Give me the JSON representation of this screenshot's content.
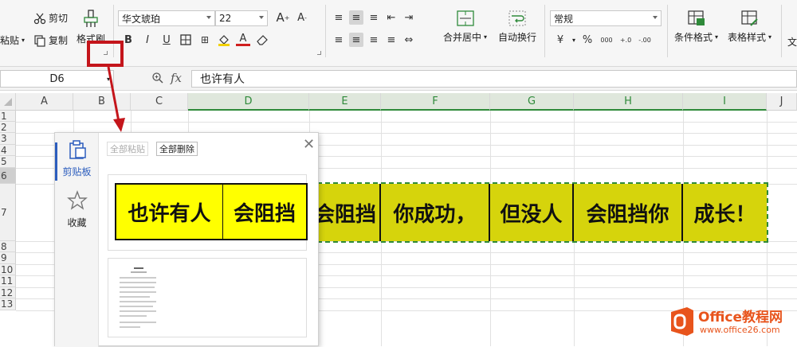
{
  "ribbon": {
    "paste_label": "粘贴",
    "cut_label": "剪切",
    "copy_label": "复制",
    "format_painter_label": "格式刷",
    "font_name": "华文琥珀",
    "font_size": "22",
    "bold": "B",
    "italic": "I",
    "underline": "U",
    "merge_center_label": "合并居中",
    "wrap_text_label": "自动换行",
    "number_format": "常规",
    "conditional_format_label": "条件格式",
    "table_style_label": "表格样式",
    "cut_off_label": "文",
    "percent": "%",
    "thousands": "000",
    "inc_decimal": "+.0",
    "dec_decimal": "-.00"
  },
  "formula_bar": {
    "name_box": "D6",
    "fx_label": "fx",
    "content": "也许有人"
  },
  "columns": [
    "A",
    "B",
    "C",
    "D",
    "E",
    "F",
    "G",
    "H",
    "I",
    "J"
  ],
  "rows": [
    "1",
    "2",
    "3",
    "4",
    "5",
    "6",
    "7",
    "8",
    "9",
    "10",
    "11",
    "12",
    "13"
  ],
  "row6_cells": [
    "会阻挡",
    "你成功，",
    "但没人",
    "会阻挡你",
    "成长！"
  ],
  "clipboard_panel": {
    "tab_clipboard": "剪贴板",
    "tab_favorites": "收藏",
    "paste_all": "全部粘贴",
    "delete_all": "全部删除",
    "item1_cells": [
      "也许有人",
      "会阻挡"
    ]
  },
  "watermark": {
    "brand": "Office教程网",
    "url": "www.office26.com"
  },
  "colors": {
    "accent_green": "#2f8a3a",
    "cell_fill": "#d6d40c",
    "clip_fill": "#ffff00",
    "annotation_red": "#c4151b",
    "brand_orange": "#e8541c"
  }
}
